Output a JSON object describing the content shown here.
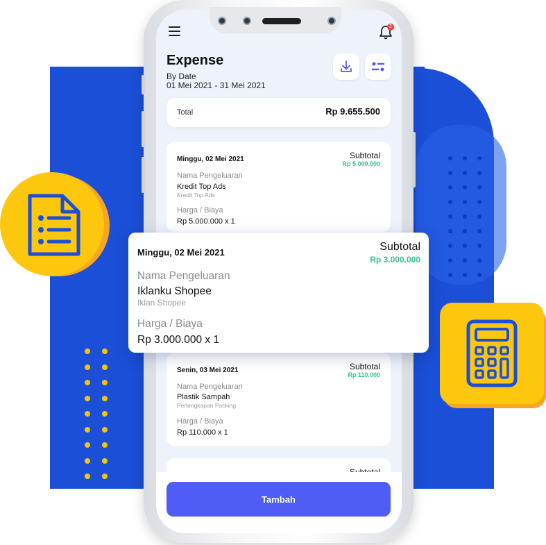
{
  "app": {
    "title": "Expense",
    "filter_label": "By Date",
    "date_range": "01 Mei 2021 - 31 Mei 2021"
  },
  "header": {
    "notification_count": "2",
    "menu_icon": "hamburger-icon",
    "bell_icon": "bell-icon"
  },
  "actions": {
    "download_icon": "download-icon",
    "filter_icon": "filter-icon"
  },
  "summary": {
    "label": "Total",
    "value": "Rp 9.655.500"
  },
  "labels": {
    "subtotal": "Subtotal",
    "name_key": "Nama Pengeluaran",
    "price_key": "Harga / Biaya"
  },
  "expenses": [
    {
      "date": "Minggu, 02 Mei 2021",
      "subtotal": "Rp 5.000.000",
      "name": "Kredit Top Ads",
      "category": "Kredit Top Ads",
      "price": "Rp 5.000.000 x 1"
    },
    {
      "date": "Minggu, 02 Mei 2021",
      "subtotal": "Rp 3.000.000",
      "name": "Iklanku Shopee",
      "category": "Iklan Shopee",
      "price": "Rp 3.000.000 x 1"
    },
    {
      "date": "Senin, 03 Mei 2021",
      "subtotal": "Rp 110.000",
      "name": "Plastik Sampah",
      "category": "Perlengkapan Packing",
      "price": "Rp 110.000 x 1"
    },
    {
      "subtotal_label": "Subtotal"
    }
  ],
  "footer": {
    "add_button": "Tambah"
  },
  "decorations": {
    "document_icon": "document-icon",
    "calculator_icon": "calculator-icon"
  },
  "colors": {
    "background_blue": "#1b4fd8",
    "accent_yellow": "#fcc70d",
    "accent_orange": "#f6a524",
    "primary_button": "#4f5cf5",
    "subtotal_green": "#34c38f",
    "badge_red": "#ef4444"
  }
}
